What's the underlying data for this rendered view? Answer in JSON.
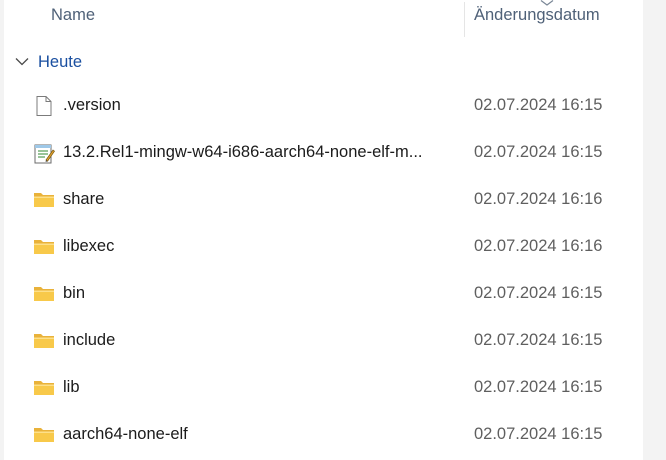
{
  "columns": {
    "name": "Name",
    "date": "Änderungsdatum"
  },
  "group": {
    "label": "Heute"
  },
  "rows": [
    {
      "name": ".version",
      "date": "02.07.2024 16:15",
      "icon": "file-icon"
    },
    {
      "name": "13.2.Rel1-mingw-w64-i686-aarch64-none-elf-m...",
      "date": "02.07.2024 16:15",
      "icon": "text-document-icon"
    },
    {
      "name": "share",
      "date": "02.07.2024 16:16",
      "icon": "folder-icon"
    },
    {
      "name": "libexec",
      "date": "02.07.2024 16:16",
      "icon": "folder-icon"
    },
    {
      "name": "bin",
      "date": "02.07.2024 16:15",
      "icon": "folder-icon"
    },
    {
      "name": "include",
      "date": "02.07.2024 16:15",
      "icon": "folder-icon"
    },
    {
      "name": "lib",
      "date": "02.07.2024 16:15",
      "icon": "folder-icon"
    },
    {
      "name": "aarch64-none-elf",
      "date": "02.07.2024 16:15",
      "icon": "folder-icon"
    }
  ],
  "colors": {
    "folder": "#f8c94a",
    "group_label": "#1a4fa0",
    "header_text": "#4f6178"
  }
}
